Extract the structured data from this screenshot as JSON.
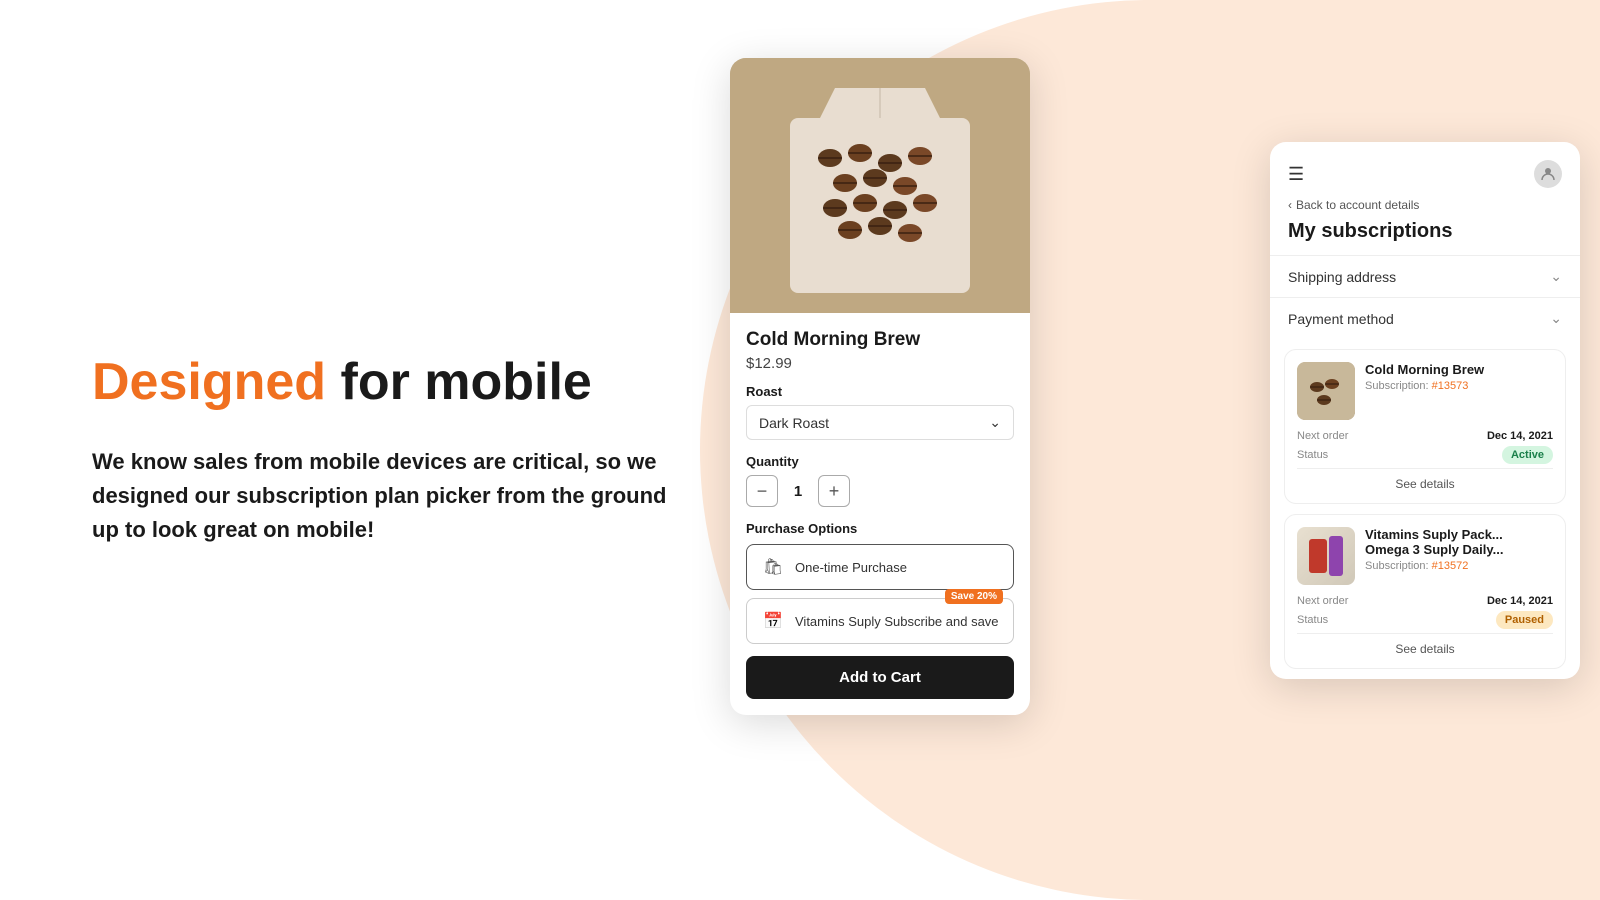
{
  "background": {
    "blob_color": "#fde8d8"
  },
  "headline": {
    "highlight": "Designed",
    "rest": " for mobile"
  },
  "subtext": "We know sales from mobile devices are critical, so we designed our subscription plan picker from the ground up to look great on mobile!",
  "product_card": {
    "product_name": "Cold Morning Brew",
    "product_price": "$12.99",
    "roast_label": "Roast",
    "roast_value": "Dark Roast",
    "quantity_label": "Quantity",
    "quantity_value": "1",
    "purchase_options_label": "Purchase Options",
    "option_one_time": "One-time Purchase",
    "option_subscribe": "Vitamins Suply Subscribe and save",
    "save_badge": "Save 20%",
    "add_to_cart": "Add to Cart"
  },
  "subscription_panel": {
    "back_link": "Back to account details",
    "title": "My subscriptions",
    "shipping_address": "Shipping address",
    "payment_method": "Payment method",
    "subscriptions": [
      {
        "name": "Cold Morning Brew",
        "subscription_label": "Subscription:",
        "subscription_number": "#13573",
        "next_order_label": "Next order",
        "next_order_value": "Dec 14, 2021",
        "status_label": "Status",
        "status_value": "Active",
        "status_type": "active",
        "see_details": "See details"
      },
      {
        "name": "Vitamins Suply Pack...",
        "name2": "Omega 3 Suply Daily...",
        "subscription_label": "Subscription:",
        "subscription_number": "#13572",
        "next_order_label": "Next order",
        "next_order_value": "Dec 14, 2021",
        "status_label": "Status",
        "status_value": "Paused",
        "status_type": "paused",
        "see_details": "See details"
      }
    ]
  },
  "icons": {
    "menu": "☰",
    "user": "👤",
    "chevron_left": "‹",
    "chevron_down": "⌄",
    "minus": "−",
    "plus": "+",
    "shopping_bag": "🛍",
    "calendar": "📅"
  }
}
